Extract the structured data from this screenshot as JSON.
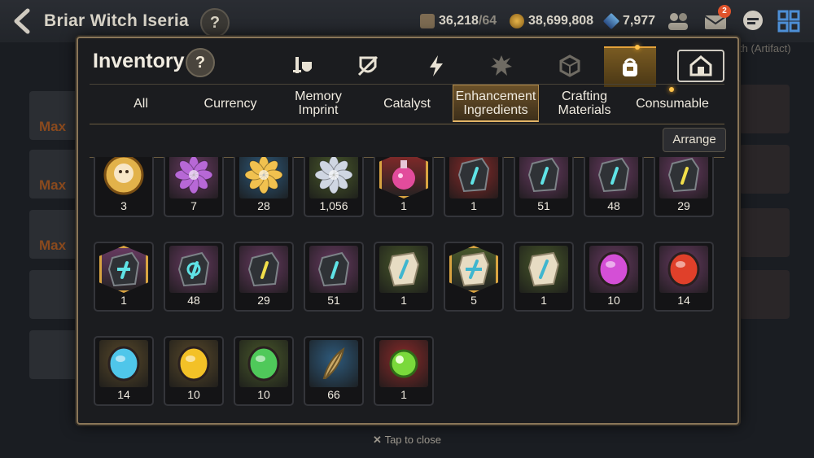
{
  "header": {
    "title": "Briar Witch Iseria",
    "help_label": "?",
    "stamina": "36,218",
    "stamina_max": "/64",
    "gold": "38,699,808",
    "skystone": "7,977",
    "mail_badge": "2",
    "artifact_hint": "th (Artifact)"
  },
  "background": {
    "side_labels": [
      "Max",
      "Max",
      "Max"
    ]
  },
  "modal": {
    "title": "Inventory",
    "help_label": "?",
    "category_tabs": [
      {
        "icon": "sword-shield-icon"
      },
      {
        "icon": "broken-shield-icon"
      },
      {
        "icon": "lightning-icon"
      },
      {
        "icon": "spiky-monster-icon"
      },
      {
        "icon": "cube-icon"
      },
      {
        "icon": "bag-icon",
        "active": true
      },
      {
        "icon": "house-icon"
      }
    ],
    "sub_tabs": [
      "All",
      "Currency",
      "Memory Imprint",
      "Catalyst",
      "Enhancement Ingredients",
      "Crafting Materials",
      "Consumable"
    ],
    "active_sub_tab": "Enhancement Ingredients",
    "arrange_label": "Arrange",
    "items": [
      {
        "icon": "phantasma-coin-icon",
        "qty": "3",
        "bg": "#7a5a2a",
        "round": true
      },
      {
        "icon": "purple-flower-icon",
        "qty": "7",
        "bg": "#6a3b63"
      },
      {
        "icon": "gold-flower-icon",
        "qty": "28",
        "bg": "#2e5a7c"
      },
      {
        "icon": "silver-flower-icon",
        "qty": "1,056",
        "bg": "#4a5a2b"
      },
      {
        "icon": "pink-potion-icon",
        "qty": "1",
        "bg": "#8a2a2a",
        "hex": true
      },
      {
        "icon": "blue-rune-stone-icon",
        "qty": "1",
        "bg": "#8a2a2a"
      },
      {
        "icon": "teal-rune-stone-icon",
        "qty": "51",
        "bg": "#6a3b63"
      },
      {
        "icon": "teal-rune-stone-icon",
        "qty": "48",
        "bg": "#6a3b63"
      },
      {
        "icon": "yellow-rune-stone-icon",
        "qty": "29",
        "bg": "#6a3b63"
      },
      {
        "icon": "cross-rune-stone-icon",
        "qty": "1",
        "bg": "#6a3b63",
        "hex": true
      },
      {
        "icon": "swirl-rune-stone-icon",
        "qty": "48",
        "bg": "#6a3b63"
      },
      {
        "icon": "yellow-rune-stone-icon",
        "qty": "29",
        "bg": "#6a3b63"
      },
      {
        "icon": "teal-rune-stone-icon",
        "qty": "51",
        "bg": "#6a3b63"
      },
      {
        "icon": "bone-rune-icon",
        "qty": "1",
        "bg": "#4a5a2b"
      },
      {
        "icon": "bone-rune-cross-icon",
        "qty": "5",
        "bg": "#4a5a2b",
        "hex": true
      },
      {
        "icon": "bone-rune-icon",
        "qty": "1",
        "bg": "#4a5a2b"
      },
      {
        "icon": "magenta-gem-icon",
        "qty": "10",
        "bg": "#6a3b63"
      },
      {
        "icon": "red-gem-icon",
        "qty": "14",
        "bg": "#6a3b63"
      },
      {
        "icon": "blue-gem-icon",
        "qty": "14",
        "bg": "#5a4a2a"
      },
      {
        "icon": "yellow-gem-icon",
        "qty": "10",
        "bg": "#5a4a2a"
      },
      {
        "icon": "green-gem-icon",
        "qty": "10",
        "bg": "#4a5a2b"
      },
      {
        "icon": "feather-root-icon",
        "qty": "66",
        "bg": "#2e5a7c"
      },
      {
        "icon": "green-orb-icon",
        "qty": "1",
        "bg": "#8a2a2a"
      }
    ]
  },
  "footer": {
    "tap_to_close": "Tap to close"
  },
  "colors": {
    "accent_gold": "#e4a23a",
    "modal_border": "#8a7658"
  }
}
